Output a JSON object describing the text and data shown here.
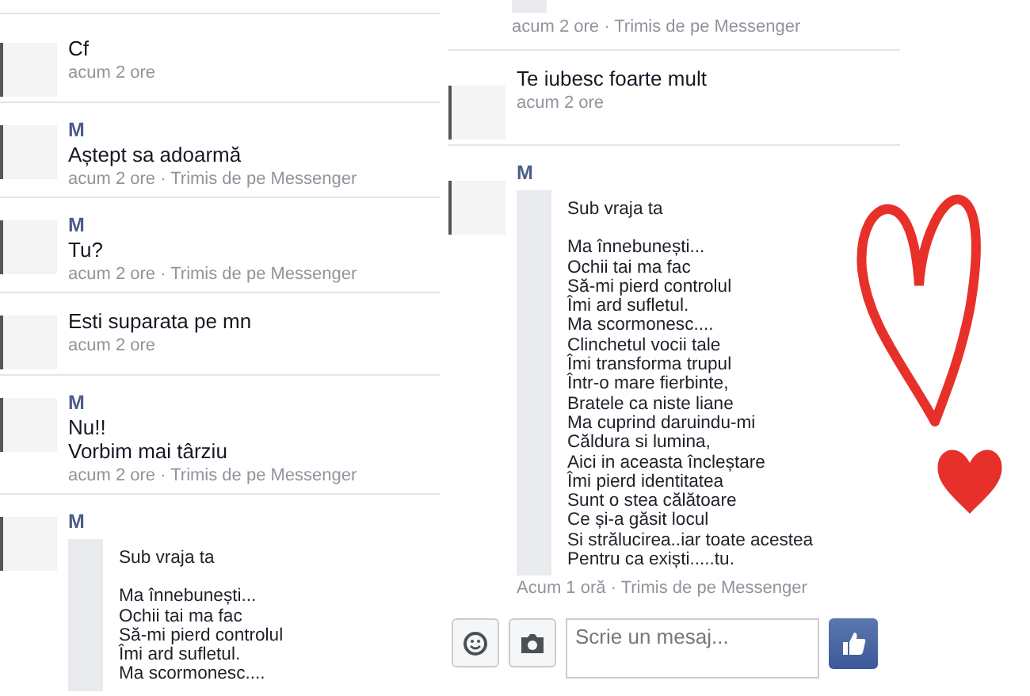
{
  "left_column": {
    "messages": [
      {
        "kind": "text",
        "lines": [
          "Cf"
        ],
        "meta": "acum 2 ore"
      },
      {
        "kind": "text",
        "sender": "M",
        "lines": [
          "Aștept sa adoarmă"
        ],
        "meta": "acum 2 ore · Trimis de pe Messenger"
      },
      {
        "kind": "text",
        "sender": "M",
        "lines": [
          "Tu?"
        ],
        "meta": "acum 2 ore · Trimis de pe Messenger"
      },
      {
        "kind": "text",
        "lines": [
          "Esti suparata pe mn"
        ],
        "meta": "acum 2 ore"
      },
      {
        "kind": "text",
        "sender": "M",
        "lines": [
          "Nu!!",
          "Vorbim mai târziu"
        ],
        "meta": "acum 2 ore · Trimis de pe Messenger"
      },
      {
        "kind": "quote",
        "sender": "M",
        "title": "Sub vraja ta",
        "lines": [
          "Ma înnebunești...",
          "Ochii tai ma fac",
          "Să-mi pierd controlul",
          "Îmi ard sufletul.",
          "Ma scormonesc...."
        ]
      }
    ]
  },
  "right_column": {
    "messages": [
      {
        "kind": "fragment",
        "meta": "acum 2 ore · Trimis de pe Messenger"
      },
      {
        "kind": "text",
        "lines": [
          "Te iubesc foarte mult"
        ],
        "meta": "acum 2 ore"
      },
      {
        "kind": "quote",
        "sender": "M",
        "title": "Sub vraja ta",
        "lines": [
          "Ma înnebunești...",
          "Ochii tai ma fac",
          "Să-mi pierd controlul",
          "Îmi ard sufletul.",
          "Ma scormonesc....",
          "Clinchetul vocii tale",
          "Îmi transforma trupul",
          "Într-o mare fierbinte,",
          "Bratele ca niste liane",
          "Ma cuprind daruindu-mi",
          "Căldura si lumina,",
          "Aici in aceasta încleștare",
          "Îmi pierd identitatea",
          "Sunt o stea călătoare",
          "Ce și-a găsit locul",
          "Si strălucirea..iar toate acestea",
          "Pentru ca exiști.....tu."
        ],
        "meta": "Acum 1 oră · Trimis de pe Messenger"
      }
    ]
  },
  "composer": {
    "placeholder": "Scrie un mesaj..."
  }
}
